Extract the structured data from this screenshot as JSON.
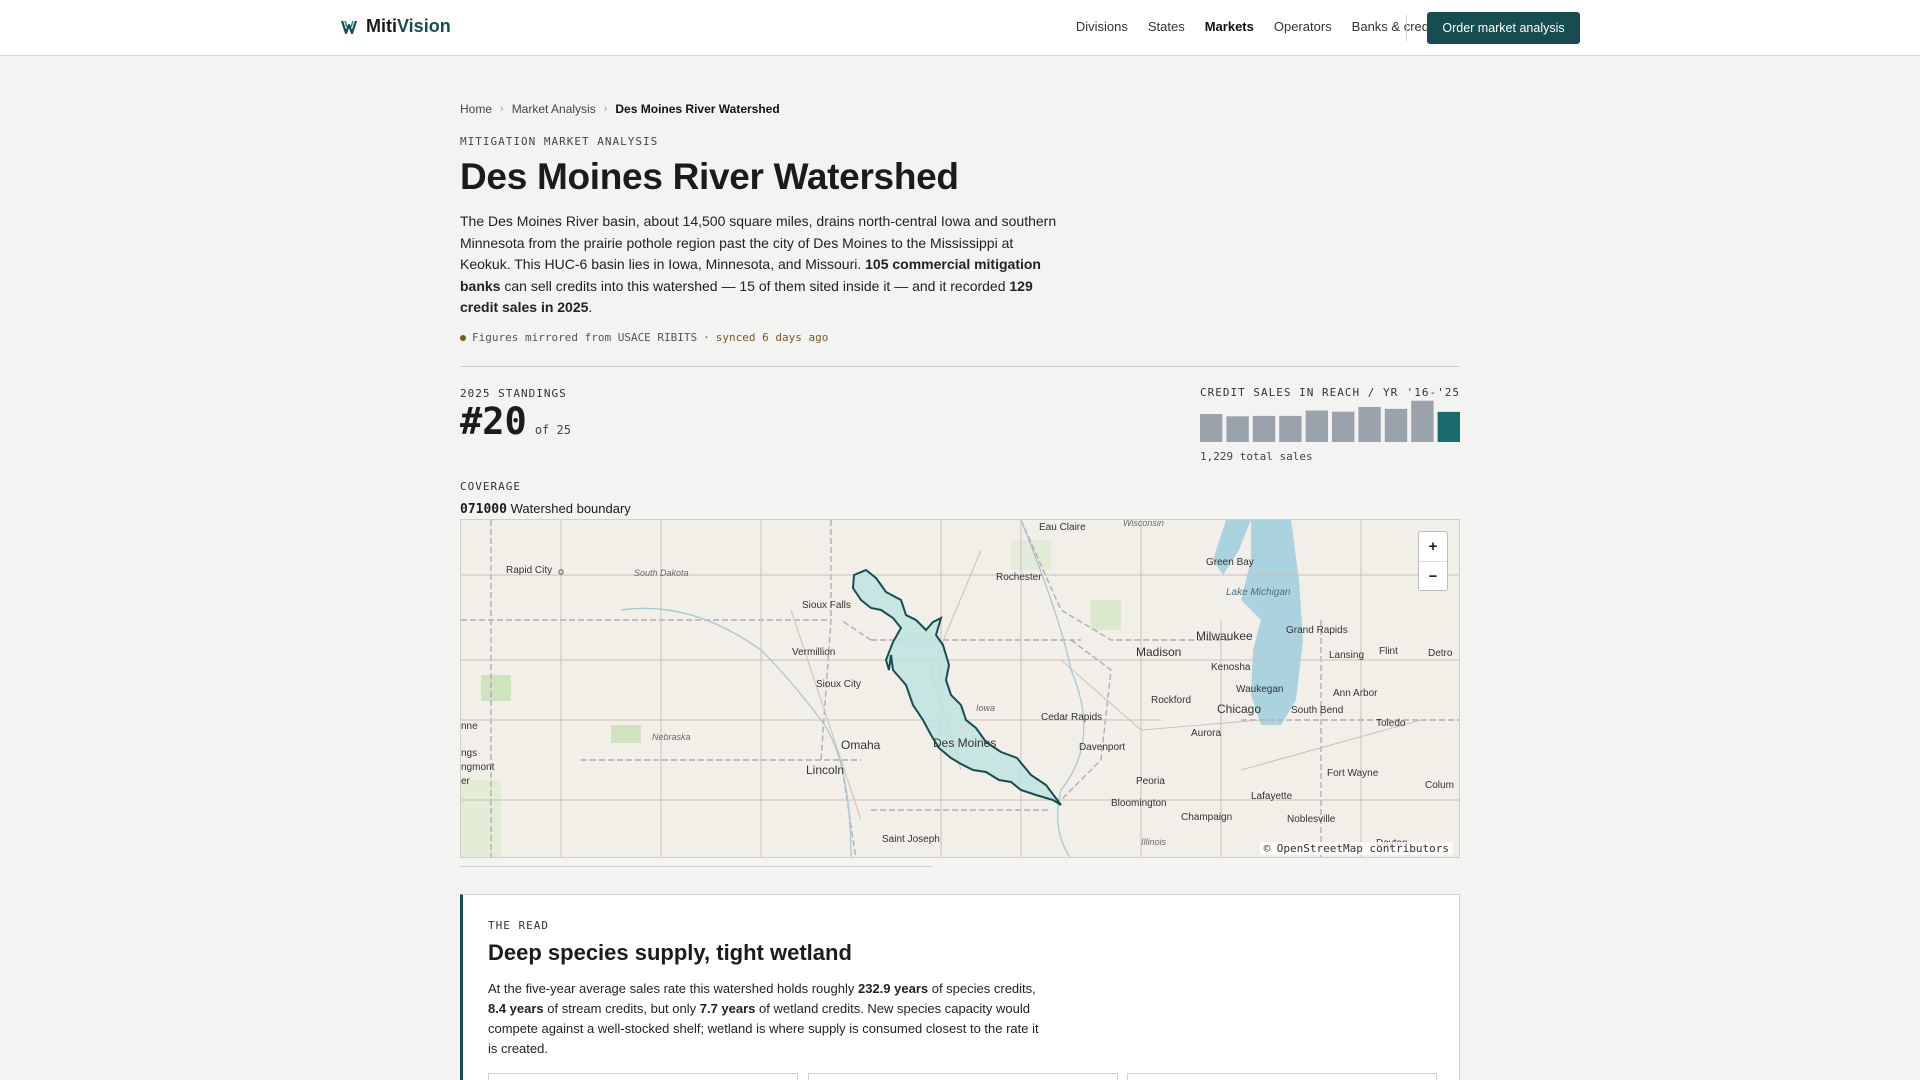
{
  "brand": {
    "name_part1": "Miti",
    "name_part2": "Vision"
  },
  "nav": {
    "items": [
      "Divisions",
      "States",
      "Markets",
      "Operators",
      "Banks & credits"
    ],
    "active": "Markets",
    "cta": "Order market analysis"
  },
  "breadcrumb": [
    "Home",
    "Market Analysis",
    "Des Moines River Watershed"
  ],
  "eyebrow": "MITIGATION MARKET ANALYSIS",
  "title": "Des Moines River Watershed",
  "intro": {
    "part1": "The Des Moines River basin, about 14,500 square miles, drains north-central Iowa and southern Minnesota from the prairie pothole region past the city of Des Moines to the Mississippi at Keokuk. This HUC-6 basin lies in Iowa, Minnesota, and Missouri. ",
    "bold1": "105 commercial mitigation banks",
    "part2": " can sell credits into this watershed — 15 of them sited inside it — and it recorded ",
    "bold2": "129 credit sales in 2025",
    "part3": "."
  },
  "sync": {
    "source": "Figures mirrored from USACE RIBITS",
    "sep": "·",
    "ago": "synced 6 days ago"
  },
  "standings": {
    "label": "2025 STANDINGS",
    "rank": "#20",
    "of": "of 25"
  },
  "sales": {
    "label": "CREDIT SALES IN REACH / YR",
    "range": "'16-'25",
    "total": "1,229 total sales",
    "colors": {
      "past": "#9aa2ab",
      "current": "#1a6b6b"
    }
  },
  "chart_data": {
    "type": "bar",
    "categories": [
      "2016",
      "2017",
      "2018",
      "2019",
      "2020",
      "2021",
      "2022",
      "2023",
      "2024",
      "2025"
    ],
    "values": [
      120,
      110,
      112,
      112,
      135,
      130,
      150,
      142,
      177,
      129
    ],
    "title": "CREDIT SALES IN REACH / YR",
    "xlabel": "",
    "ylabel": "",
    "ylim": [
      0,
      180
    ]
  },
  "coverage": {
    "label": "COVERAGE",
    "code": "071000",
    "name": "Watershed boundary"
  },
  "map": {
    "attribution": "© OpenStreetMap contributors",
    "zoom_in": "+",
    "zoom_out": "−",
    "watershed_fill": "#bfe3df",
    "watershed_stroke": "#174d50",
    "cities": [
      "Rapid City",
      "Sioux Falls",
      "Vermillion",
      "Sioux City",
      "Omaha",
      "Lincoln",
      "Saint Joseph",
      "Rochester",
      "Eau Claire",
      "Des Moines",
      "Cedar Rapids",
      "Davenport",
      "Peoria",
      "Bloomington",
      "Champaign",
      "Madison",
      "Milwaukee",
      "Kenosha",
      "Waukegan",
      "Rockford",
      "Aurora",
      "Chicago",
      "South Bend",
      "Green Bay",
      "Grand Rapids",
      "Lansing",
      "Flint",
      "Ann Arbor",
      "Toledo",
      "Fort Wayne",
      "Lafayette",
      "Noblesville",
      "Dayton",
      "Detro",
      "nne",
      "ngs",
      "ngmont",
      "er",
      "Colum"
    ],
    "regions": [
      "South Dakota",
      "Nebraska",
      "Iowa",
      "Wisconsin",
      "Illinois",
      "Lake Michigan"
    ]
  },
  "read": {
    "label": "THE READ",
    "heading": "Deep species supply, tight wetland",
    "t1": "At the five-year average sales rate this watershed holds roughly ",
    "b1": "232.9 years",
    "t2": " of species credits, ",
    "b2": "8.4 years",
    "t3": " of stream credits, but only ",
    "b3": "7.7 years",
    "t4": " of wetland credits. New species capacity would compete against a well-stocked shelf; wetland is where supply is consumed closest to the rate it is created."
  }
}
